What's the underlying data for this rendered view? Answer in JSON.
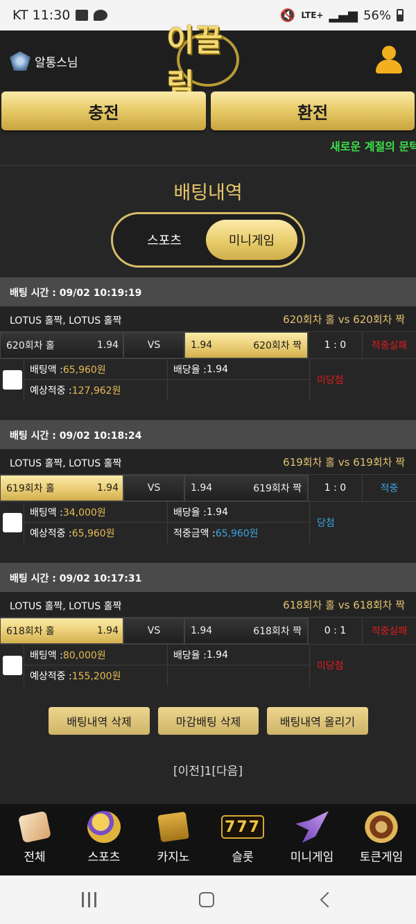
{
  "status_bar": {
    "carrier_time": "KT 11:30",
    "network": "LTE+",
    "battery": "56%"
  },
  "header": {
    "username": "알통스님",
    "logo": "이끌림"
  },
  "top_buttons": {
    "charge": "충전",
    "exchange": "환전"
  },
  "marquee": "새로운 계절의 문턱",
  "page_title": "배팅내역",
  "toggle": {
    "sports": "스포츠",
    "minigame": "미니게임",
    "selected": "미니게임"
  },
  "bets": [
    {
      "time": "배팅 시간 : 09/02 10:19:19",
      "event": "LOTUS 홀짝, LOTUS 홀짝",
      "match": "620회차 홀  vs  620회차 짝",
      "home": "620회차 홀",
      "home_odds": "1.94",
      "vs": "VS",
      "away_odds": "1.94",
      "away": "620회차 짝",
      "selected": "away",
      "score": "1 : 0",
      "result": "적중실패",
      "stake_label": "배팅액 :",
      "stake": "65,960원",
      "odds_label": "배당율 :",
      "odds": "1.94",
      "expect_label": "예상적중 :",
      "expect": "127,962원",
      "win_label": "",
      "win": "",
      "status": "미당첨"
    },
    {
      "time": "배팅 시간 : 09/02 10:18:24",
      "event": "LOTUS 홀짝, LOTUS 홀짝",
      "match": "619회차 홀  vs  619회차 짝",
      "home": "619회차 홀",
      "home_odds": "1.94",
      "vs": "VS",
      "away_odds": "1.94",
      "away": "619회차 짝",
      "selected": "home",
      "score": "1 : 0",
      "result": "적중",
      "stake_label": "배팅액 :",
      "stake": "34,000원",
      "odds_label": "배당율 :",
      "odds": "1.94",
      "expect_label": "예상적중 :",
      "expect": "65,960원",
      "win_label": "적중금액 :",
      "win": "65,960원",
      "status": "당첨"
    },
    {
      "time": "배팅 시간 : 09/02 10:17:31",
      "event": "LOTUS 홀짝, LOTUS 홀짝",
      "match": "618회차 홀  vs  618회차 짝",
      "home": "618회차 홀",
      "home_odds": "1.94",
      "vs": "VS",
      "away_odds": "1.94",
      "away": "618회차 짝",
      "selected": "home",
      "score": "0 : 1",
      "result": "적중실패",
      "stake_label": "배팅액 :",
      "stake": "80,000원",
      "odds_label": "배당율 :",
      "odds": "1.94",
      "expect_label": "예상적중 :",
      "expect": "155,200원",
      "win_label": "",
      "win": "",
      "status": "미당첨"
    }
  ],
  "actions": {
    "delete": "배팅내역 삭제",
    "delete_closed": "마감배팅 삭제",
    "upload": "배팅내역 올리기"
  },
  "pager": "[이전]1[다음]",
  "bottom_nav": [
    {
      "label": "전체",
      "icon": "dice-icon"
    },
    {
      "label": "스포츠",
      "icon": "soccer-ball-icon"
    },
    {
      "label": "카지노",
      "icon": "cards-icon"
    },
    {
      "label": "슬롯",
      "icon": "slot-777-icon",
      "glyph": "777"
    },
    {
      "label": "미니게임",
      "icon": "rocket-icon"
    },
    {
      "label": "토큰게임",
      "icon": "roulette-icon"
    }
  ],
  "colors": {
    "gold": "#e6c56a",
    "fail": "#e11c1c",
    "win": "#3aa5e0",
    "marquee": "#3be04a"
  }
}
